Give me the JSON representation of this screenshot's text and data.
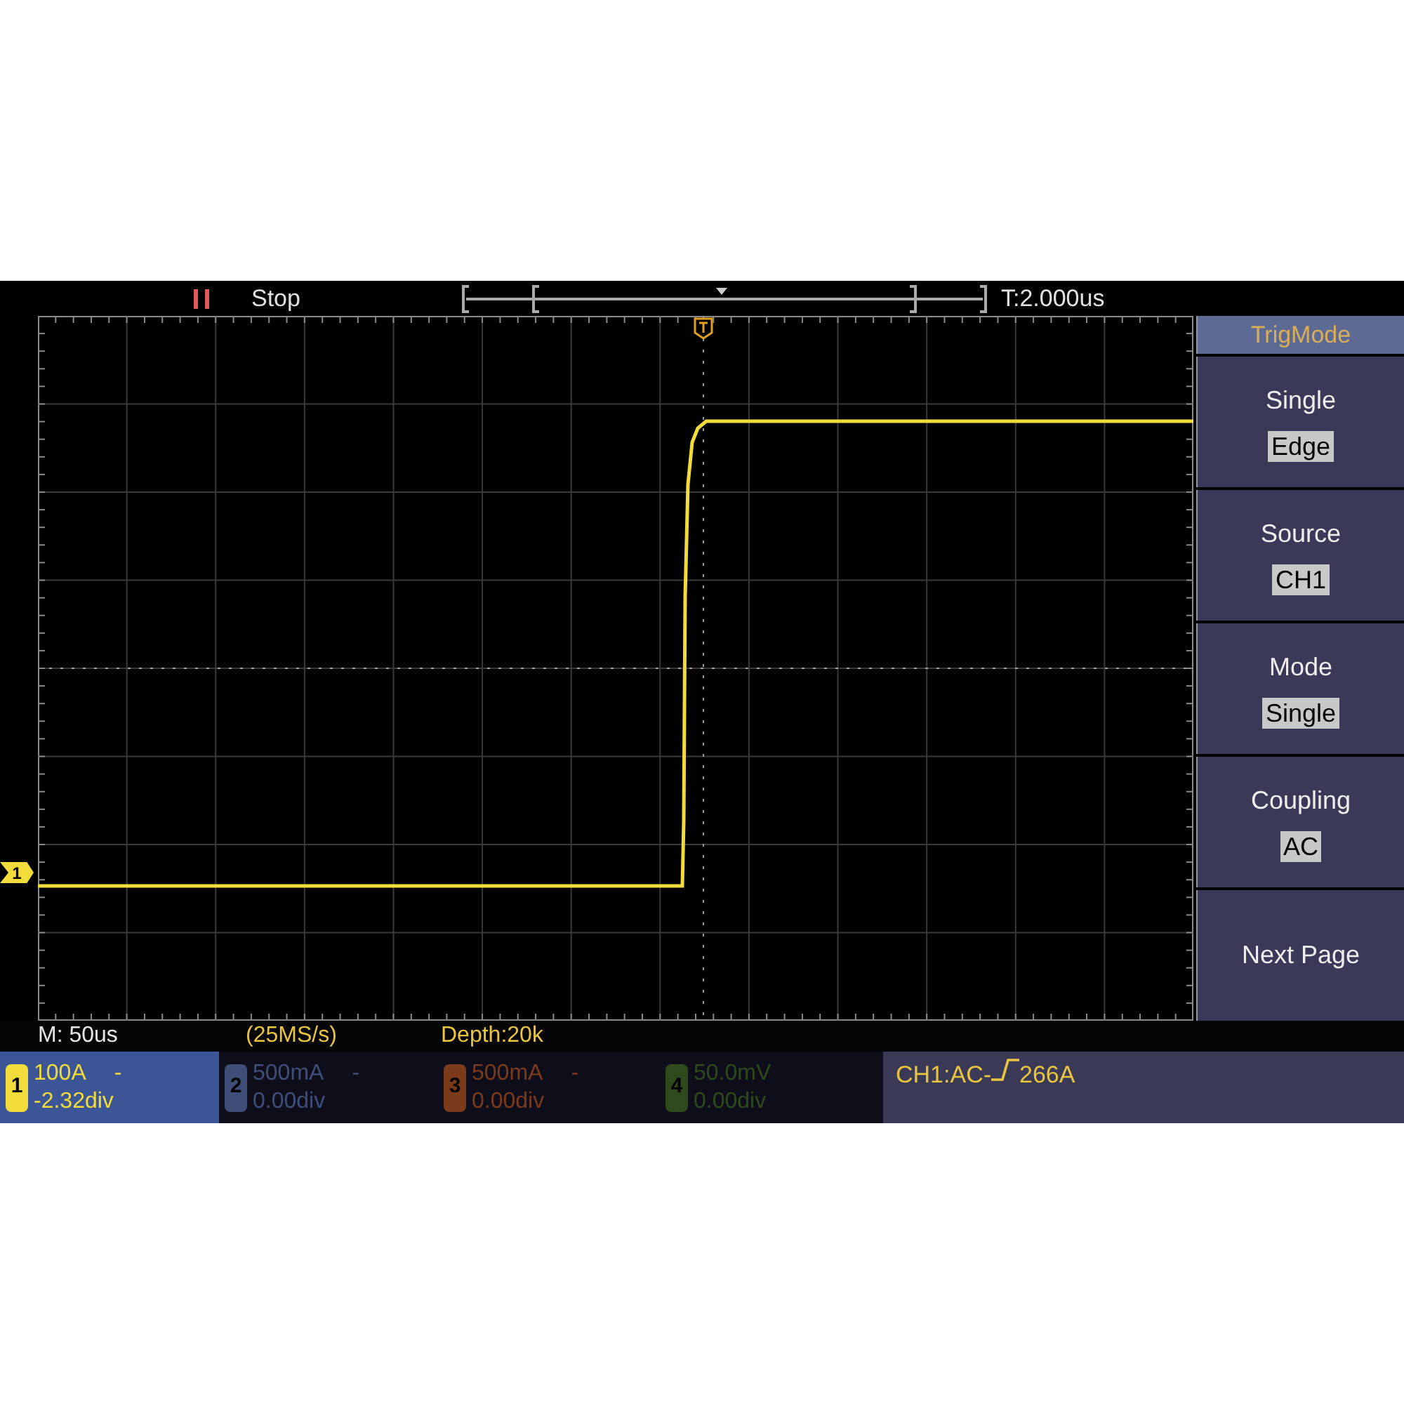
{
  "status": {
    "state": "Stop",
    "trigger_time": "T:2.000us"
  },
  "menu": {
    "title": "TrigMode",
    "items": [
      {
        "label": "Single",
        "value": "Edge"
      },
      {
        "label": "Source",
        "value": "CH1"
      },
      {
        "label": "Mode",
        "value": "Single"
      },
      {
        "label": "Coupling",
        "value": "AC"
      },
      {
        "label": "Next Page"
      }
    ]
  },
  "info": {
    "timebase": "M: 50us",
    "sample_rate": "(25MS/s)",
    "depth": "Depth:20k"
  },
  "trigger_level_marker": "1",
  "channels": [
    {
      "number": "1",
      "scale": "100A",
      "suffix": "-",
      "offset": "-2.32div",
      "color": "#f2dc3c",
      "active": true
    },
    {
      "number": "2",
      "scale": "500mA",
      "suffix": "-",
      "offset": "0.00div",
      "color": "#3e4e78",
      "active": false
    },
    {
      "number": "3",
      "scale": "500mA",
      "suffix": "-",
      "offset": "0.00div",
      "color": "#7c3a1c",
      "active": false
    },
    {
      "number": "4",
      "scale": "50.0mV",
      "offset": "0.00div",
      "color": "#2e4a1c",
      "active": false
    }
  ],
  "trigger_info": {
    "prefix": "CH1:AC-",
    "level": "266A"
  }
}
